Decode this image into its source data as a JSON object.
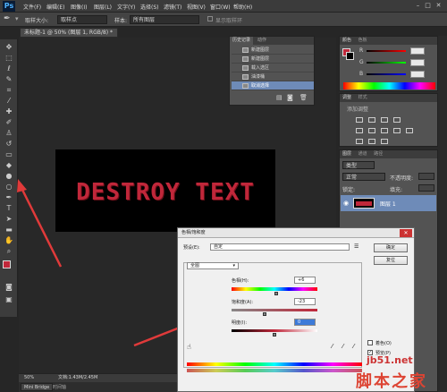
{
  "app": {
    "logo": "Ps",
    "menus": [
      "文件(F)",
      "编辑(E)",
      "图像(I)",
      "图层(L)",
      "文字(Y)",
      "选择(S)",
      "滤镜(T)",
      "视图(V)",
      "窗口(W)",
      "帮助(H)"
    ],
    "window_min": "–",
    "window_max": "□",
    "window_close": "✕"
  },
  "options": {
    "sample_size_label": "取样大小:",
    "sample_size_value": "取样点",
    "sample_label": "样本:",
    "sample_value": "所有图层",
    "show_ring": "显示取样环"
  },
  "document": {
    "tab_title": "未标题-1 @ 50% (图层 1, RGB/8) *",
    "canvas_text": "DESTROY TEXT",
    "zoom": "50%",
    "doc_info": "文档:1.43M/2.45M",
    "mini_bridge": "Mini Bridge",
    "timeline": "时间轴"
  },
  "history": {
    "tabs": [
      "历史记录",
      "动作"
    ],
    "items": [
      "新建图层",
      "新建图层",
      "载入选区",
      "油漆桶",
      "取消选择"
    ]
  },
  "color_panel": {
    "tabs": [
      "颜色",
      "色板"
    ],
    "channels": [
      "R",
      "G",
      "B"
    ],
    "values": [
      "",
      "",
      ""
    ]
  },
  "adjust_panel": {
    "tabs": [
      "调整",
      "样式"
    ],
    "add_adjust": "添加调整"
  },
  "layers_panel": {
    "tabs": [
      "图层",
      "通道",
      "路径"
    ],
    "filter": "类型",
    "blend": "正常",
    "opacity_label": "不透明度:",
    "opacity_value": "",
    "lock_label": "锁定:",
    "fill_label": "填充:",
    "fill_value": "",
    "layer_name": "图层 1"
  },
  "dialog": {
    "title": "色相/饱和度",
    "preset_label": "预设(E):",
    "preset_value": "自定",
    "ok": "确定",
    "reset": "复位",
    "channel": "全图",
    "hue_label": "色相(H):",
    "hue_value": "+6",
    "hue": 6,
    "sat_label": "饱和度(A):",
    "sat_value": "-23",
    "saturation": -23,
    "light_label": "明度(I):",
    "light_value": "0",
    "lightness": 0,
    "colorize": "着色(O)",
    "preview": "预览(P)"
  },
  "watermark": {
    "site": "jb51.net",
    "brand": "脚本之家"
  },
  "colors": {
    "accent": "#c0273a",
    "arrow": "#e03a3a",
    "highlight": "#6e8bb8"
  }
}
